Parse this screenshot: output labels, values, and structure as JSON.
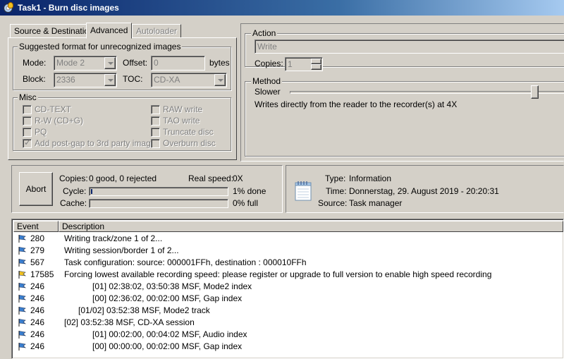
{
  "window": {
    "title": "Task1 - Burn disc images"
  },
  "tabs": [
    {
      "label": "Source & Destination",
      "active": false,
      "disabled": false
    },
    {
      "label": "Advanced",
      "active": true,
      "disabled": false
    },
    {
      "label": "Autoloader",
      "active": false,
      "disabled": true
    }
  ],
  "suggested": {
    "title": "Suggested format for unrecognized images",
    "mode_label": "Mode:",
    "mode_value": "Mode 2",
    "offset_label": "Offset:",
    "offset_value": "0",
    "offset_unit": "bytes",
    "block_label": "Block:",
    "block_value": "2336",
    "toc_label": "TOC:",
    "toc_value": "CD-XA"
  },
  "misc": {
    "title": "Misc",
    "options": [
      {
        "label": "CD-TEXT",
        "checked": false
      },
      {
        "label": "R-W (CD+G)",
        "checked": false
      },
      {
        "label": "PQ",
        "checked": false
      },
      {
        "label": "Add post-gap to 3rd party images",
        "checked": true
      },
      {
        "label": "RAW write",
        "checked": false
      },
      {
        "label": "TAO write",
        "checked": false
      },
      {
        "label": "Truncate disc",
        "checked": false
      },
      {
        "label": "Overburn disc",
        "checked": false
      }
    ]
  },
  "action": {
    "title": "Action",
    "value": "Write",
    "copies_label": "Copies:",
    "copies_value": "1"
  },
  "method": {
    "title": "Method",
    "speed_label": "Slower",
    "description": "Writes directly from the reader to the recorder(s) at 4X"
  },
  "status": {
    "abort_label": "Abort",
    "copies_label": "Copies:",
    "copies_value": "0 good, 0 rejected",
    "real_speed_label": "Real speed:",
    "real_speed_value": "0X",
    "cycle_label": "Cycle:",
    "cycle_percent_text": "1% done",
    "cycle_progress": 0.01,
    "cache_label": "Cache:",
    "cache_percent_text": "0% full",
    "cache_progress": 0.0
  },
  "info": {
    "type_label": "Type:",
    "type_value": "Information",
    "time_label": "Time:",
    "time_value": "Donnerstag, 29. August 2019 - 20:20:31",
    "source_label": "Source:",
    "source_value": "Task manager",
    "icon": "notepad-icon"
  },
  "log": {
    "columns": [
      "Event",
      "Description"
    ],
    "rows": [
      {
        "event": "280",
        "description": "Writing track/zone 1 of 2...",
        "flag": "blue"
      },
      {
        "event": "279",
        "description": "Writing session/border 1 of 2...",
        "flag": "blue"
      },
      {
        "event": "567",
        "description": "Task configuration: source: 000001FFh, destination : 000010FFh",
        "flag": "blue"
      },
      {
        "event": "17585",
        "description": "Forcing lowest available recording speed: please register or upgrade to full version to enable high speed recording",
        "flag": "yellow"
      },
      {
        "event": "246",
        "description": "            [01] 02:38:02, 03:50:38 MSF, Mode2 index",
        "flag": "blue"
      },
      {
        "event": "246",
        "description": "            [00] 02:36:02, 00:02:00 MSF, Gap index",
        "flag": "blue"
      },
      {
        "event": "246",
        "description": "      [01/02] 03:52:38 MSF, Mode2 track",
        "flag": "blue"
      },
      {
        "event": "246",
        "description": "[02] 03:52:38 MSF, CD-XA session",
        "flag": "blue"
      },
      {
        "event": "246",
        "description": "            [01] 00:02:00, 00:04:02 MSF, Audio index",
        "flag": "blue"
      },
      {
        "event": "246",
        "description": "            [00] 00:00:00, 00:02:00 MSF, Gap index",
        "flag": "blue"
      }
    ]
  },
  "colors": {
    "titlebar_start": "#0a246a",
    "flag_blue": "#3a7fd0",
    "flag_yellow": "#f0c020"
  }
}
